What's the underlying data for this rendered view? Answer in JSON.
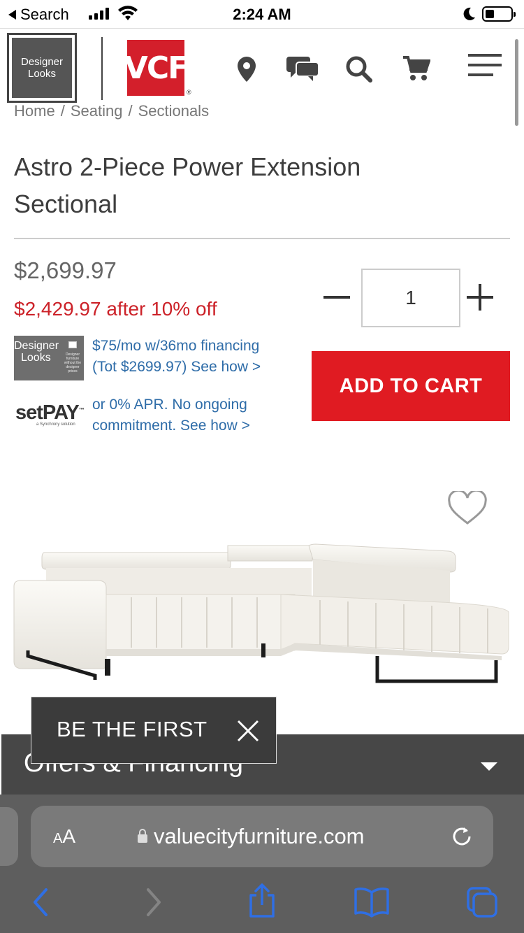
{
  "status_bar": {
    "back_label": "Search",
    "time": "2:24 AM"
  },
  "header": {
    "designer_logo_line1": "Designer",
    "designer_logo_line2": "Looks",
    "vcf_logo": "VCF",
    "vcf_reg": "®",
    "icons": [
      "location-pin-icon",
      "chat-icon",
      "search-icon",
      "cart-icon",
      "menu-icon"
    ]
  },
  "breadcrumb": [
    "Home",
    "/",
    "Seating",
    "/",
    "Sectionals"
  ],
  "product": {
    "title": "Astro 2-Piece Power Extension Sectional",
    "price": "$2,699.97",
    "sale_price": "$2,429.97 after 10% off",
    "quantity": "1",
    "add_to_cart": "ADD TO CART"
  },
  "financing": {
    "designer_logo_line1": "Designer",
    "designer_logo_line2": "Looks",
    "designer_logo_tagline": "Designer furniture without the designer prices",
    "plan1_line1": "$75/mo w/36mo financing",
    "plan1_line2": "(Tot $2699.97) See how >",
    "setpay_logo": "setPAY",
    "setpay_tm": "™",
    "setpay_sub": "a Synchrony solution",
    "plan2_line1": "or 0% APR. No ongoing",
    "plan2_line2": "commitment. See how >"
  },
  "offers": {
    "label": "Offers & Financing"
  },
  "popup": {
    "label": "BE THE FIRST"
  },
  "browser": {
    "aa_label": "A",
    "aa_small": "A",
    "url": "valuecityfurniture.com"
  },
  "colors": {
    "brand_red": "#e01b22",
    "sale_red": "#cc2229",
    "link_blue": "#2e6ca8",
    "safari_tint": "#2f6fe4"
  }
}
